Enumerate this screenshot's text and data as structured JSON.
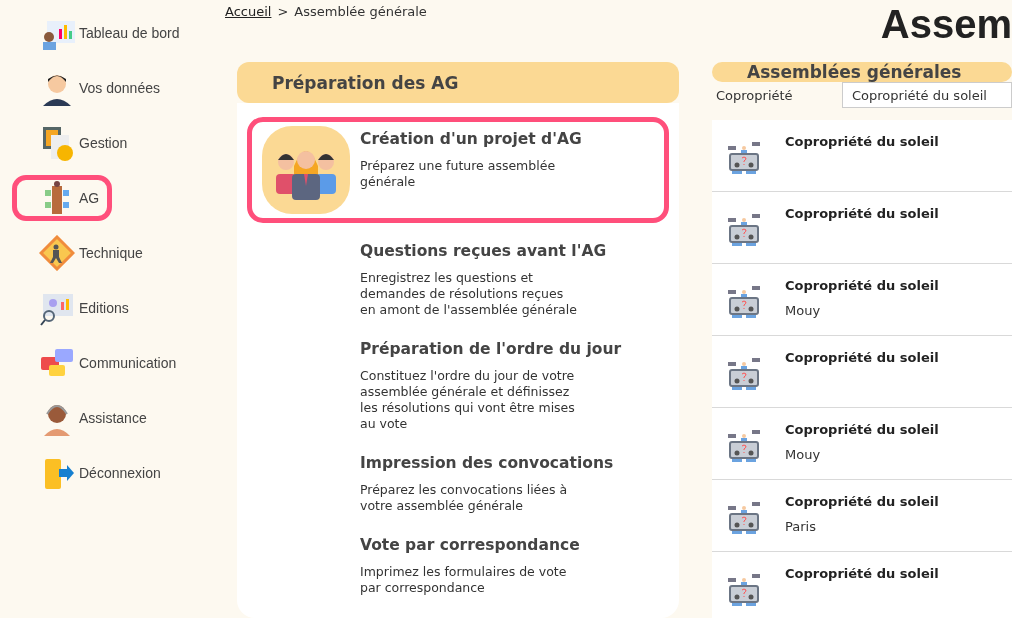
{
  "sidebar": {
    "items": [
      {
        "label": "Tableau de bord",
        "selected": false
      },
      {
        "label": "Vos données",
        "selected": false
      },
      {
        "label": "Gestion",
        "selected": false
      },
      {
        "label": "AG",
        "selected": true
      },
      {
        "label": "Technique",
        "selected": false
      },
      {
        "label": "Editions",
        "selected": false
      },
      {
        "label": "Communication",
        "selected": false
      },
      {
        "label": "Assistance",
        "selected": false
      },
      {
        "label": "Déconnexion",
        "selected": false
      }
    ]
  },
  "breadcrumb": {
    "link": "Accueil",
    "separator": ">",
    "current": "Assemblée générale"
  },
  "page_title": "Assem",
  "preparation": {
    "title": "Préparation des AG",
    "items": [
      {
        "title": "Création d'un projet d'AG",
        "description": "Préparez une future assemblée générale",
        "highlighted": true
      },
      {
        "title": "Questions reçues avant l'AG",
        "description": "Enregistrez les questions et demandes de résolutions reçues en amont de l'assemblée générale",
        "highlighted": false
      },
      {
        "title": "Préparation de l'ordre du jour",
        "description": "Constituez l'ordre du jour de votre assemblée générale et définissez les résolutions qui vont être mises au vote",
        "highlighted": false
      },
      {
        "title": "Impression des convocations",
        "description": "Préparez les convocations liées à votre assemblée générale",
        "highlighted": false
      },
      {
        "title": "Vote par correspondance",
        "description": "Imprimez les formulaires de vote par correspondance",
        "highlighted": false
      }
    ]
  },
  "assemblies": {
    "title": "Assemblées générales",
    "filter": {
      "label": "Copropriété",
      "value": "Copropriété du soleil"
    },
    "rows": [
      {
        "name": "Copropriété du soleil"
      },
      {
        "name": "Copropriété du soleil"
      },
      {
        "name": "Copropriété du soleil",
        "city": "Mouy"
      },
      {
        "name": "Copropriété du soleil"
      },
      {
        "name": "Copropriété du soleil",
        "city": "Mouy"
      },
      {
        "name": "Copropriété du soleil",
        "city": "Paris"
      },
      {
        "name": "Copropriété du soleil"
      }
    ]
  }
}
